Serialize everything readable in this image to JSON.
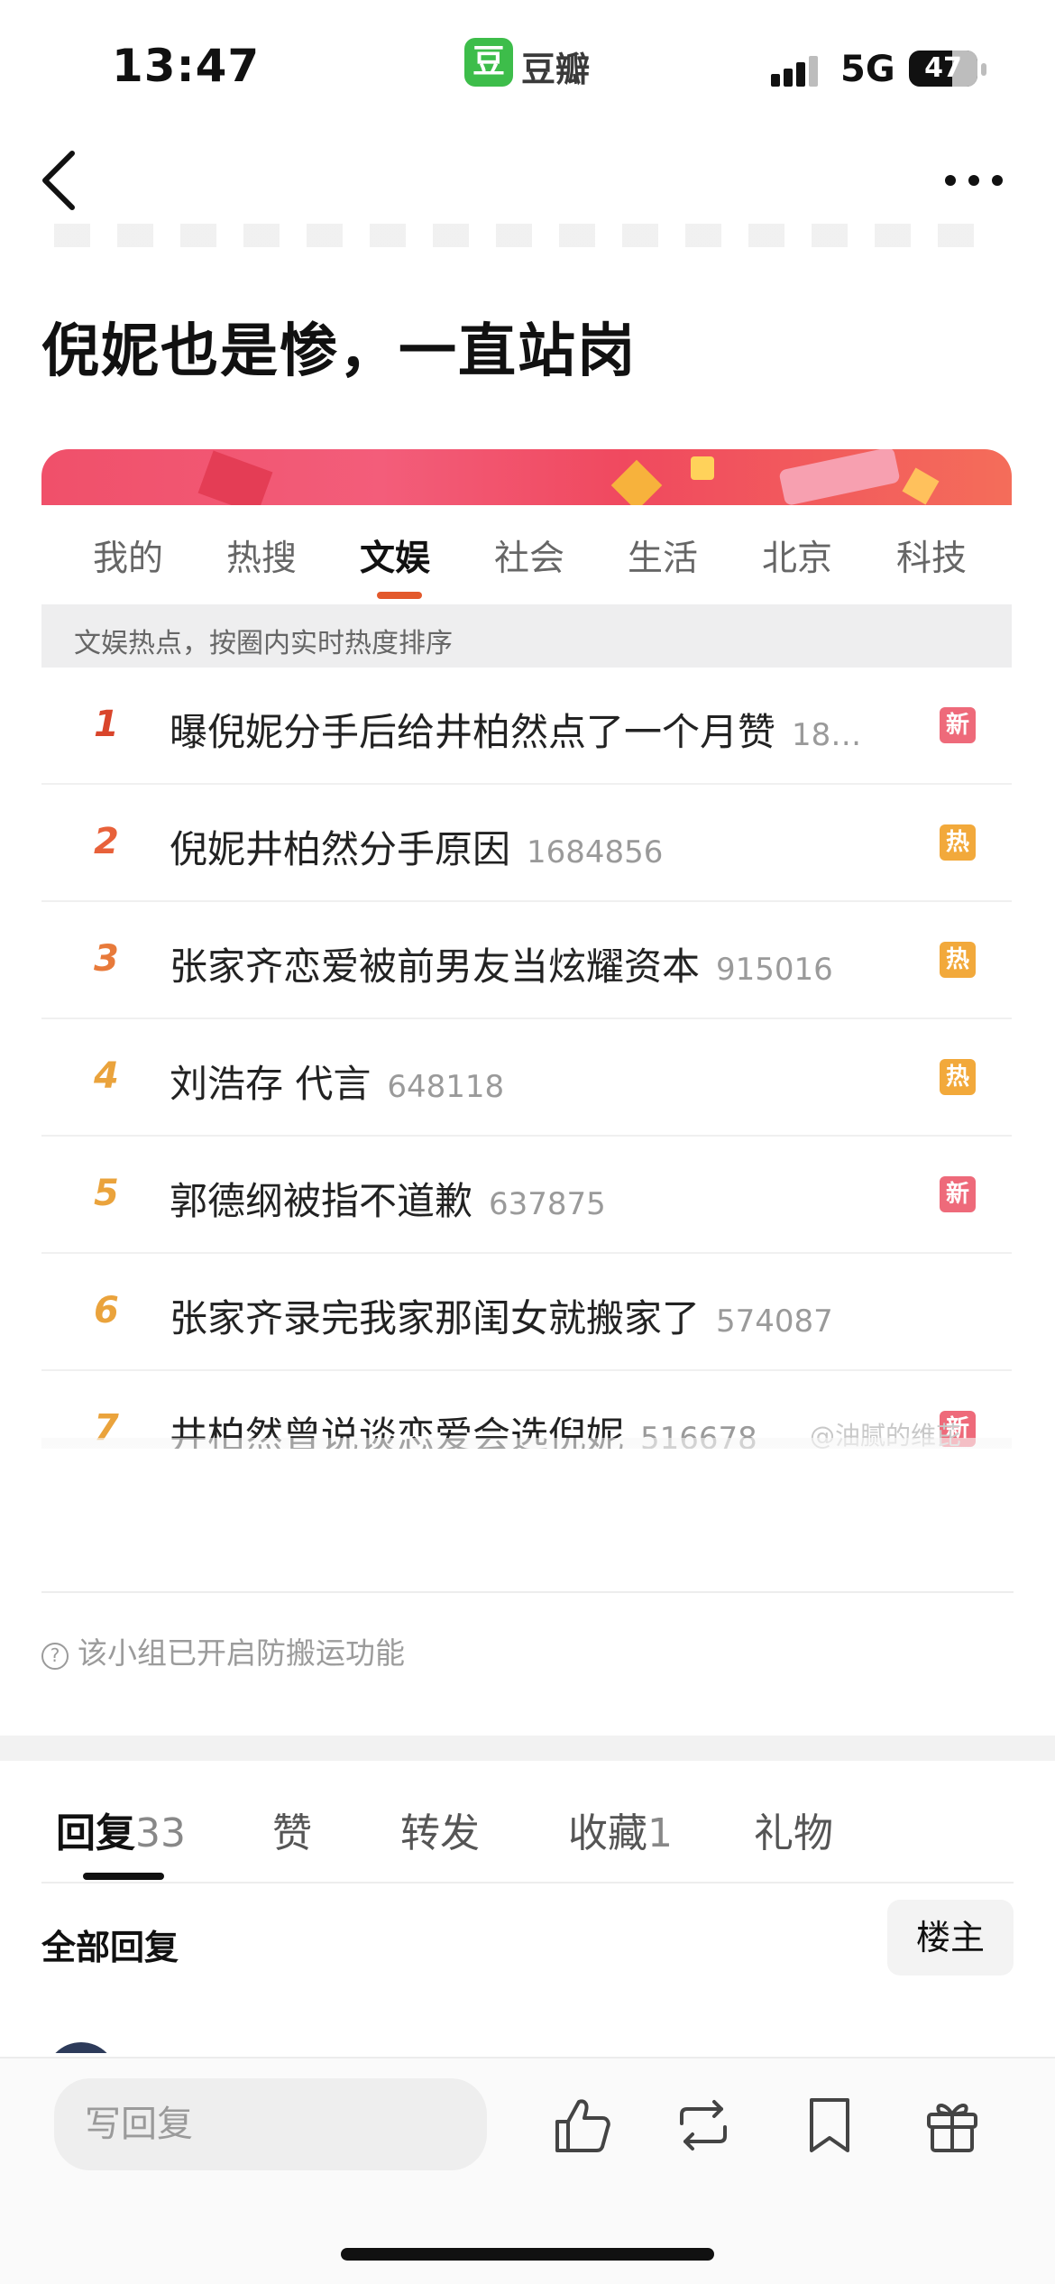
{
  "status_bar": {
    "time": "13:47",
    "app_badge": "豆",
    "app_name": "豆瓣",
    "network": "5G",
    "battery": "47"
  },
  "post": {
    "title": "倪妮也是惨，一直站岗"
  },
  "hot_search": {
    "tabs": [
      "我的",
      "热搜",
      "文娱",
      "社会",
      "生活",
      "北京",
      "科技"
    ],
    "active_tab": "文娱",
    "info": "文娱热点，按圈内实时热度排序",
    "items": [
      {
        "rank": "1",
        "title": "曝倪妮分手后给井柏然点了一个月赞",
        "count": "18…",
        "tag": "新",
        "tag_type": "new",
        "rank_color": "#d9452b"
      },
      {
        "rank": "2",
        "title": "倪妮井柏然分手原因",
        "count": "1684856",
        "tag": "热",
        "tag_type": "hot",
        "rank_color": "#e8613a"
      },
      {
        "rank": "3",
        "title": "张家齐恋爱被前男友当炫耀资本",
        "count": "915016",
        "tag": "热",
        "tag_type": "hot",
        "rank_color": "#e87a3a"
      },
      {
        "rank": "4",
        "title": "刘浩存 代言",
        "count": "648118",
        "tag": "热",
        "tag_type": "hot",
        "rank_color": "#eaa33c"
      },
      {
        "rank": "5",
        "title": "郭德纲被指不道歉",
        "count": "637875",
        "tag": "新",
        "tag_type": "new",
        "rank_color": "#eaa33c"
      },
      {
        "rank": "6",
        "title": "张家齐录完我家那闺女就搬家了",
        "count": "574087",
        "tag": "",
        "tag_type": "",
        "rank_color": "#eaa33c"
      },
      {
        "rank": "7",
        "title": "井柏然曾说谈恋爱会选倪妮",
        "count": "516678",
        "tag": "新",
        "tag_type": "new",
        "rank_color": "#eaa33c"
      }
    ],
    "watermark": "@油腻的维芘"
  },
  "notice": {
    "icon": "?",
    "text": "该小组已开启防搬运功能"
  },
  "interaction_tabs": [
    {
      "label": "回复",
      "count": "33"
    },
    {
      "label": "赞",
      "count": ""
    },
    {
      "label": "转发",
      "count": ""
    },
    {
      "label": "收藏",
      "count": "1"
    },
    {
      "label": "礼物",
      "count": ""
    }
  ],
  "replies": {
    "header": "全部回复",
    "owner_filter": "楼主"
  },
  "bottom_bar": {
    "reply_placeholder": "写回复"
  },
  "colors": {
    "douban_green": "#3dbd4a",
    "tab_underline": "#e3592c",
    "tag_new": "#ee6a7a",
    "tag_hot": "#f2a93b"
  }
}
